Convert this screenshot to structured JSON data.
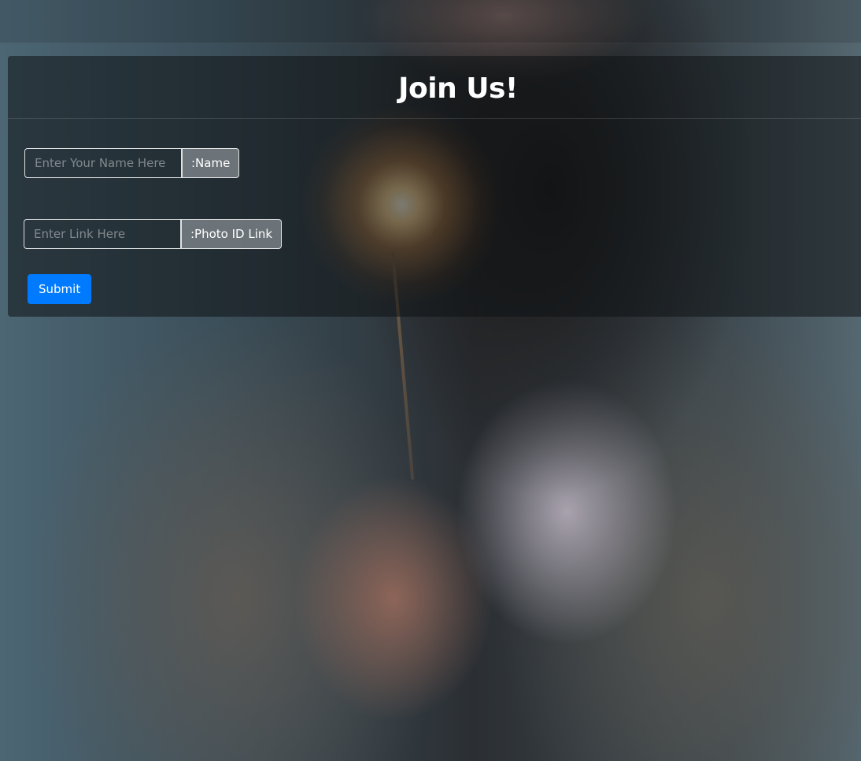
{
  "form": {
    "title": "Join Us!",
    "name_placeholder": "Enter Your Name Here",
    "name_label": ":Name",
    "link_placeholder": "Enter Link Here",
    "link_label": ":Photo ID Link",
    "submit_label": "Submit"
  },
  "colors": {
    "submit_button": "#007bff",
    "card_background": "rgba(15,18,20,0.55)"
  }
}
